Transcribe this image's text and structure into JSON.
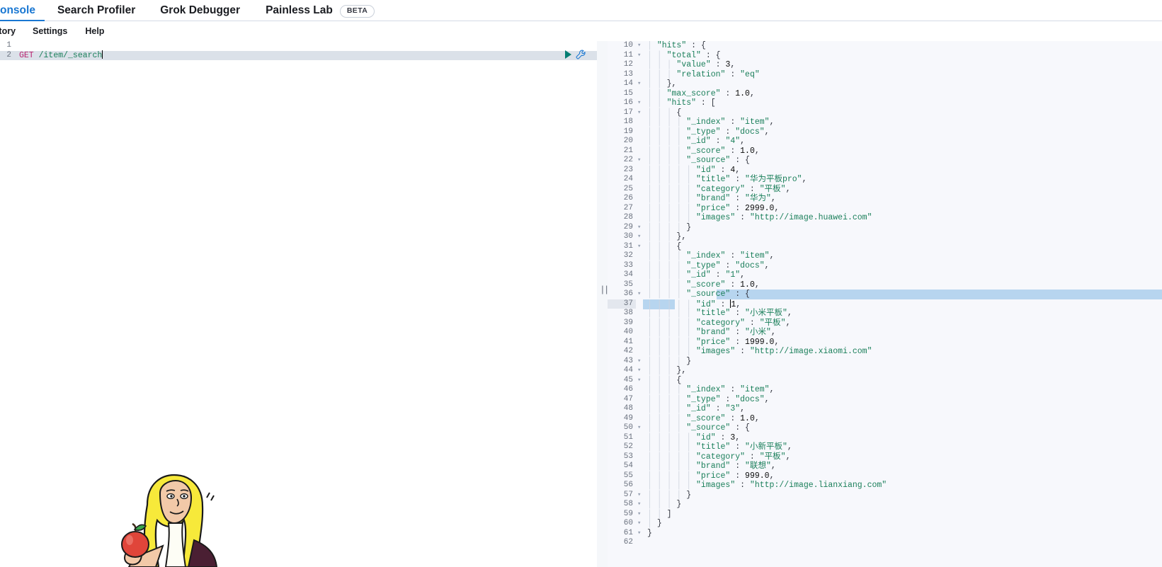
{
  "topnav": {
    "tabs": [
      {
        "label": "onsole",
        "full_label": "Console",
        "active": true
      },
      {
        "label": "Search Profiler",
        "active": false
      },
      {
        "label": "Grok Debugger",
        "active": false
      },
      {
        "label": "Painless Lab",
        "active": false
      }
    ],
    "beta_badge": "BETA"
  },
  "submenu": {
    "items": [
      {
        "label": "istory",
        "full_label": "History"
      },
      {
        "label": "Settings"
      },
      {
        "label": "Help"
      }
    ]
  },
  "editor": {
    "actions": {
      "play_icon": "play-icon",
      "wrench_icon": "wrench-icon"
    },
    "active_line": 2,
    "lines": [
      {
        "num": "1",
        "method": "",
        "url": ""
      },
      {
        "num": "2",
        "method": "GET",
        "url": " /item/_search"
      }
    ],
    "illustration": "newton-apple-illustration"
  },
  "splitter": {
    "handle": "||"
  },
  "response": {
    "watermark_icon": "search-icon",
    "selected_line": 36,
    "cursor_line": 37,
    "lines": [
      {
        "num": "10",
        "fold": "▾",
        "indent": 1,
        "text": "\"hits\" : {"
      },
      {
        "num": "11",
        "fold": "▾",
        "indent": 2,
        "text": "\"total\" : {"
      },
      {
        "num": "12",
        "fold": "",
        "indent": 3,
        "text": "\"value\" : 3,"
      },
      {
        "num": "13",
        "fold": "",
        "indent": 3,
        "text": "\"relation\" : \"eq\""
      },
      {
        "num": "14",
        "fold": "▾",
        "indent": 2,
        "text": "},"
      },
      {
        "num": "15",
        "fold": "",
        "indent": 2,
        "text": "\"max_score\" : 1.0,"
      },
      {
        "num": "16",
        "fold": "▾",
        "indent": 2,
        "text": "\"hits\" : ["
      },
      {
        "num": "17",
        "fold": "▾",
        "indent": 3,
        "text": "{"
      },
      {
        "num": "18",
        "fold": "",
        "indent": 4,
        "text": "\"_index\" : \"item\","
      },
      {
        "num": "19",
        "fold": "",
        "indent": 4,
        "text": "\"_type\" : \"docs\","
      },
      {
        "num": "20",
        "fold": "",
        "indent": 4,
        "text": "\"_id\" : \"4\","
      },
      {
        "num": "21",
        "fold": "",
        "indent": 4,
        "text": "\"_score\" : 1.0,"
      },
      {
        "num": "22",
        "fold": "▾",
        "indent": 4,
        "text": "\"_source\" : {"
      },
      {
        "num": "23",
        "fold": "",
        "indent": 5,
        "text": "\"id\" : 4,"
      },
      {
        "num": "24",
        "fold": "",
        "indent": 5,
        "text": "\"title\" : \"华为平板pro\","
      },
      {
        "num": "25",
        "fold": "",
        "indent": 5,
        "text": "\"category\" : \"平板\","
      },
      {
        "num": "26",
        "fold": "",
        "indent": 5,
        "text": "\"brand\" : \"华为\","
      },
      {
        "num": "27",
        "fold": "",
        "indent": 5,
        "text": "\"price\" : 2999.0,"
      },
      {
        "num": "28",
        "fold": "",
        "indent": 5,
        "text": "\"images\" : \"http://image.huawei.com\""
      },
      {
        "num": "29",
        "fold": "▾",
        "indent": 4,
        "text": "}"
      },
      {
        "num": "30",
        "fold": "▾",
        "indent": 3,
        "text": "},"
      },
      {
        "num": "31",
        "fold": "▾",
        "indent": 3,
        "text": "{"
      },
      {
        "num": "32",
        "fold": "",
        "indent": 4,
        "text": "\"_index\" : \"item\","
      },
      {
        "num": "33",
        "fold": "",
        "indent": 4,
        "text": "\"_type\" : \"docs\","
      },
      {
        "num": "34",
        "fold": "",
        "indent": 4,
        "text": "\"_id\" : \"1\","
      },
      {
        "num": "35",
        "fold": "",
        "indent": 4,
        "text": "\"_score\" : 1.0,"
      },
      {
        "num": "36",
        "fold": "▾",
        "indent": 4,
        "text": "\"_source\" : {"
      },
      {
        "num": "37",
        "fold": "",
        "indent": 5,
        "text": "\"id\" : 1,"
      },
      {
        "num": "38",
        "fold": "",
        "indent": 5,
        "text": "\"title\" : \"小米平板\","
      },
      {
        "num": "39",
        "fold": "",
        "indent": 5,
        "text": "\"category\" : \"平板\","
      },
      {
        "num": "40",
        "fold": "",
        "indent": 5,
        "text": "\"brand\" : \"小米\","
      },
      {
        "num": "41",
        "fold": "",
        "indent": 5,
        "text": "\"price\" : 1999.0,"
      },
      {
        "num": "42",
        "fold": "",
        "indent": 5,
        "text": "\"images\" : \"http://image.xiaomi.com\""
      },
      {
        "num": "43",
        "fold": "▾",
        "indent": 4,
        "text": "}"
      },
      {
        "num": "44",
        "fold": "▾",
        "indent": 3,
        "text": "},"
      },
      {
        "num": "45",
        "fold": "▾",
        "indent": 3,
        "text": "{"
      },
      {
        "num": "46",
        "fold": "",
        "indent": 4,
        "text": "\"_index\" : \"item\","
      },
      {
        "num": "47",
        "fold": "",
        "indent": 4,
        "text": "\"_type\" : \"docs\","
      },
      {
        "num": "48",
        "fold": "",
        "indent": 4,
        "text": "\"_id\" : \"3\","
      },
      {
        "num": "49",
        "fold": "",
        "indent": 4,
        "text": "\"_score\" : 1.0,"
      },
      {
        "num": "50",
        "fold": "▾",
        "indent": 4,
        "text": "\"_source\" : {"
      },
      {
        "num": "51",
        "fold": "",
        "indent": 5,
        "text": "\"id\" : 3,"
      },
      {
        "num": "52",
        "fold": "",
        "indent": 5,
        "text": "\"title\" : \"小新平板\","
      },
      {
        "num": "53",
        "fold": "",
        "indent": 5,
        "text": "\"category\" : \"平板\","
      },
      {
        "num": "54",
        "fold": "",
        "indent": 5,
        "text": "\"brand\" : \"联想\","
      },
      {
        "num": "55",
        "fold": "",
        "indent": 5,
        "text": "\"price\" : 999.0,"
      },
      {
        "num": "56",
        "fold": "",
        "indent": 5,
        "text": "\"images\" : \"http://image.lianxiang.com\""
      },
      {
        "num": "57",
        "fold": "▾",
        "indent": 4,
        "text": "}"
      },
      {
        "num": "58",
        "fold": "▾",
        "indent": 3,
        "text": "}"
      },
      {
        "num": "59",
        "fold": "▾",
        "indent": 2,
        "text": "]"
      },
      {
        "num": "60",
        "fold": "▾",
        "indent": 1,
        "text": "}"
      },
      {
        "num": "61",
        "fold": "▾",
        "indent": 0,
        "text": "}"
      },
      {
        "num": "62",
        "fold": "",
        "indent": 0,
        "text": ""
      }
    ]
  },
  "colors": {
    "accent": "#1977d2",
    "play": "#017d73",
    "string": "#1a7f5a",
    "method": "#b9216e",
    "selection": "#b7d5ef",
    "response_bg": "#f7f8fc",
    "watermark_bg": "#f6dfe2"
  }
}
